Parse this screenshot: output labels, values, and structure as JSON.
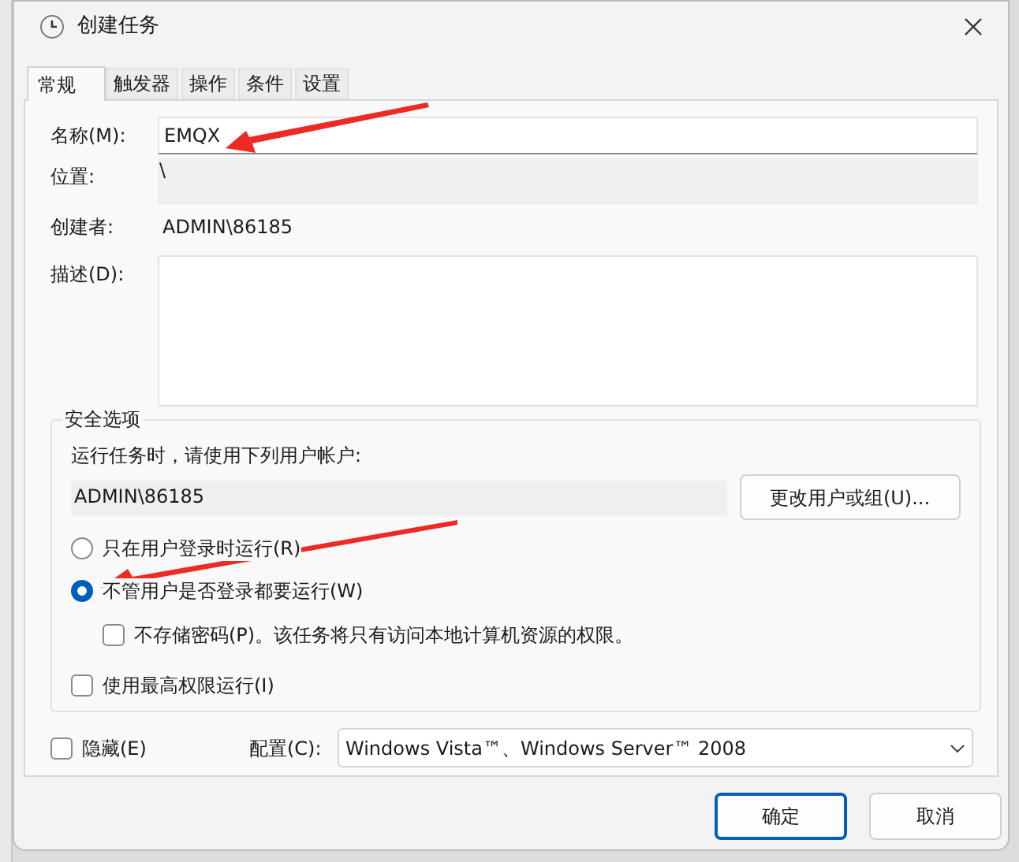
{
  "window": {
    "title": "创建任务"
  },
  "tabs": [
    {
      "label": "常规",
      "selected": true
    },
    {
      "label": "触发器",
      "selected": false
    },
    {
      "label": "操作",
      "selected": false
    },
    {
      "label": "条件",
      "selected": false
    },
    {
      "label": "设置",
      "selected": false
    }
  ],
  "fields": [
    {
      "label": "名称(M):",
      "kind": "input",
      "value": "EMQX"
    },
    {
      "label": "位置:",
      "kind": "readonly",
      "value": "\\"
    },
    {
      "label": "创建者:",
      "kind": "text",
      "value": "ADMIN\\86185"
    },
    {
      "label": "描述(D):",
      "kind": "textarea"
    }
  ],
  "security": {
    "title": "安全选项",
    "prompt": "运行任务时，请使用下列用户帐户:",
    "account": "ADMIN\\86185",
    "change_button": "更改用户或组(U)...",
    "options": [
      {
        "label": "只在用户登录时运行(R)",
        "selected": false
      },
      {
        "label": "不管用户是否登录都要运行(W)",
        "selected": true,
        "children": [
          {
            "label": "不存储密码(P)。该任务将只有访问本地计算机资源的权限。",
            "checked": false
          }
        ]
      }
    ],
    "run_highest": {
      "label": "使用最高权限运行(I)",
      "checked": false
    }
  },
  "hidden": {
    "label": "隐藏(E)",
    "checked": false
  },
  "config": {
    "label": "配置(C):",
    "value": "Windows Vista™、Windows Server™ 2008"
  },
  "buttons": [
    {
      "label": "确定",
      "selected": true
    },
    {
      "label": "取消",
      "selected": false
    }
  ]
}
